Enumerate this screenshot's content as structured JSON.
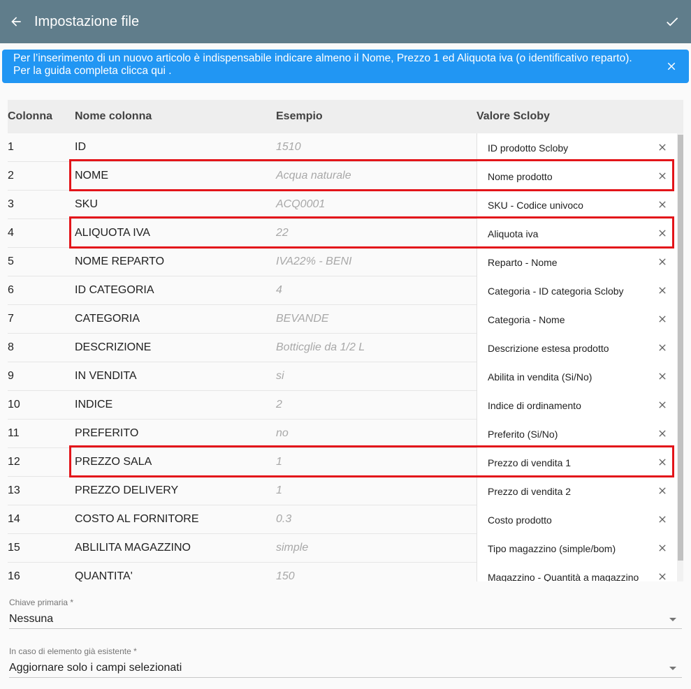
{
  "toolbar": {
    "title": "Impostazione file",
    "back_icon": "arrow-left-icon",
    "confirm_icon": "check-icon"
  },
  "banner": {
    "line1": "Per l’inserimento di un nuovo articolo è indispensabile indicare almeno il Nome, Prezzo 1 ed Aliquota iva (o identificativo reparto).",
    "line2": "Per la guida completa clicca qui .",
    "color": "#2196f3"
  },
  "table": {
    "headers": {
      "col": "Colonna",
      "name": "Nome colonna",
      "example": "Esempio",
      "value": "Valore Scloby"
    },
    "rows": [
      {
        "col": "1",
        "name": "ID",
        "example": "1510",
        "value": "ID prodotto Scloby"
      },
      {
        "col": "2",
        "name": "NOME",
        "example": "Acqua naturale",
        "value": "Nome prodotto"
      },
      {
        "col": "3",
        "name": "SKU",
        "example": "ACQ0001",
        "value": "SKU - Codice univoco"
      },
      {
        "col": "4",
        "name": "ALIQUOTA IVA",
        "example": "22",
        "value": "Aliquota iva"
      },
      {
        "col": "5",
        "name": "NOME REPARTO",
        "example": "IVA22% - BENI",
        "value": "Reparto - Nome"
      },
      {
        "col": "6",
        "name": "ID CATEGORIA",
        "example": "4",
        "value": "Categoria -  ID categoria Scloby"
      },
      {
        "col": "7",
        "name": "CATEGORIA",
        "example": "BEVANDE",
        "value": "Categoria - Nome"
      },
      {
        "col": "8",
        "name": "DESCRIZIONE",
        "example": "Botticglie da 1/2 L",
        "value": "Descrizione estesa prodotto"
      },
      {
        "col": "9",
        "name": "IN VENDITA",
        "example": "si",
        "value": "Abilita in vendita (Si/No)"
      },
      {
        "col": "10",
        "name": "INDICE",
        "example": "2",
        "value": "Indice di ordinamento"
      },
      {
        "col": "11",
        "name": "PREFERITO",
        "example": "no",
        "value": "Preferito (Si/No)"
      },
      {
        "col": "12",
        "name": "PREZZO SALA",
        "example": "1",
        "value": "Prezzo di vendita 1"
      },
      {
        "col": "13",
        "name": "PREZZO DELIVERY",
        "example": "1",
        "value": "Prezzo di vendita 2"
      },
      {
        "col": "14",
        "name": "COSTO AL FORNITORE",
        "example": "0.3",
        "value": "Costo prodotto"
      },
      {
        "col": "15",
        "name": "ABLILITA MAGAZZINO",
        "example": "simple",
        "value": "Tipo magazzino (simple/bom)"
      },
      {
        "col": "16",
        "name": "QUANTITA'",
        "example": "150",
        "value": "Magazzino - Quantità a magazzino"
      }
    ],
    "highlighted_rows": [
      "2",
      "4",
      "12"
    ],
    "highlight_color": "#e3151a"
  },
  "primary_key": {
    "label": "Chiave primaria *",
    "value": "Nessuna"
  },
  "existing": {
    "label": "In caso di elemento già esistente *",
    "value": "Aggiornare solo i campi selezionati"
  }
}
